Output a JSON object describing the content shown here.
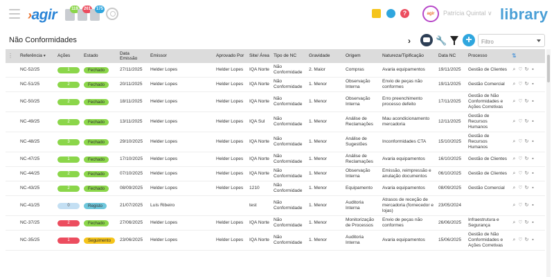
{
  "header": {
    "logo_prefix": "·",
    "logo_text": "agir",
    "notifications": [
      {
        "count": "119",
        "color": "#8bd64a"
      },
      {
        "count": "261",
        "color": "#ec4d5f"
      },
      {
        "count": "175",
        "color": "#2fa6de"
      }
    ],
    "user_name": "Patrícia Quintal",
    "user_chevron": "∨",
    "brand": "library",
    "avatar_text": "agir"
  },
  "page": {
    "title": "Não Conformidades",
    "filter_placeholder": "Filtro",
    "add_label": "+"
  },
  "columns": [
    "Referência",
    "Ações",
    "Estado",
    "Data Emissão",
    "Emissor",
    "Aprovado Por",
    "Site/ Área",
    "Tipo de NC",
    "Gravidade",
    "Origem",
    "Natureza/Tipificação",
    "Data NC",
    "Processo"
  ],
  "rows": [
    {
      "ref": "NC-52/25",
      "acoes": "1",
      "acoes_color": "g",
      "estado": "Fechado",
      "estado_cls": "fechado",
      "data": "27/11/2025",
      "emissor": "Helder Lopes",
      "aprovado": "Helder Lopes",
      "site": "IQA Norte",
      "tipo": "Não Conformidade",
      "gravidade": "2. Maior",
      "origem": "Compras",
      "natureza": "Avaria equipamentos",
      "data_nc": "19/11/2025",
      "processo": "Gestão de Clientes"
    },
    {
      "ref": "NC-51/25",
      "acoes": "2",
      "acoes_color": "g",
      "estado": "Fechado",
      "estado_cls": "fechado",
      "data": "20/11/2025",
      "emissor": "Helder Lopes",
      "aprovado": "Helder Lopes",
      "site": "IQA Norte",
      "tipo": "Não Conformidade",
      "gravidade": "1. Menor",
      "origem": "Observação Interna",
      "natureza": "Envio de peças não conformes",
      "data_nc": "19/11/2025",
      "processo": "Gestão Comercial"
    },
    {
      "ref": "NC-50/25",
      "acoes": "2",
      "acoes_color": "g",
      "estado": "Fechado",
      "estado_cls": "fechado",
      "data": "18/11/2025",
      "emissor": "Helder Lopes",
      "aprovado": "Helder Lopes",
      "site": "IQA Norte",
      "tipo": "Não Conformidade",
      "gravidade": "1. Menor",
      "origem": "Observação Interna",
      "natureza": "Erro preenchimento processo defeito",
      "data_nc": "17/11/2025",
      "processo": "Gestão de Não Conformidades e Ações Corretivas"
    },
    {
      "ref": "NC-49/25",
      "acoes": "2",
      "acoes_color": "g",
      "estado": "Fechado",
      "estado_cls": "fechado",
      "data": "13/11/2025",
      "emissor": "Helder Lopes",
      "aprovado": "Helder Lopes",
      "site": "IQA Sul",
      "tipo": "Não Conformidade",
      "gravidade": "1. Menor",
      "origem": "Análise de Reclamações",
      "natureza": "Mau acondicionamento mercadoria",
      "data_nc": "12/11/2025",
      "processo": "Gestão de Recursos Humanos"
    },
    {
      "ref": "NC-48/25",
      "acoes": "3",
      "acoes_color": "g",
      "estado": "Fechado",
      "estado_cls": "fechado",
      "data": "29/10/2025",
      "emissor": "Helder Lopes",
      "aprovado": "Helder Lopes",
      "site": "IQA Norte",
      "tipo": "Não Conformidade",
      "gravidade": "1. Menor",
      "origem": "Análise de Sugestões",
      "natureza": "Inconformidades CTA",
      "data_nc": "15/10/2025",
      "processo": "Gestão de Recursos Humanos"
    },
    {
      "ref": "NC-47/25",
      "acoes": "1",
      "acoes_color": "g",
      "estado": "Fechado",
      "estado_cls": "fechado",
      "data": "17/10/2025",
      "emissor": "Helder Lopes",
      "aprovado": "Helder Lopes",
      "site": "IQA Norte",
      "tipo": "Não Conformidade",
      "gravidade": "1. Menor",
      "origem": "Análise de Reclamações",
      "natureza": "Avaria equipamentos",
      "data_nc": "16/10/2025",
      "processo": "Gestão de Clientes"
    },
    {
      "ref": "NC-44/25",
      "acoes": "2",
      "acoes_color": "g",
      "estado": "Fechado",
      "estado_cls": "fechado",
      "data": "07/10/2025",
      "emissor": "Helder Lopes",
      "aprovado": "Helder Lopes",
      "site": "IQA Norte",
      "tipo": "Não Conformidade",
      "gravidade": "1. Menor",
      "origem": "Observação Interna",
      "natureza": "Emissão, reimpressão e anulação documentos",
      "data_nc": "06/10/2025",
      "processo": "Gestão de Clientes"
    },
    {
      "ref": "NC-43/25",
      "acoes": "2",
      "acoes_color": "g",
      "estado": "Fechado",
      "estado_cls": "fechado",
      "data": "08/09/2025",
      "emissor": "Helder Lopes",
      "aprovado": "Helder Lopes",
      "site": "1210",
      "tipo": "Não Conformidade",
      "gravidade": "1. Menor",
      "origem": "Equipamento",
      "natureza": "Avaria equipamentos",
      "data_nc": "08/09/2025",
      "processo": "Gestão Comercial"
    },
    {
      "ref": "NC-41/25",
      "acoes": "0",
      "acoes_color": "b",
      "estado": "Registo",
      "estado_cls": "registo",
      "data": "21/07/2025",
      "emissor": "Luís Ribeiro",
      "aprovado": "",
      "site": "test",
      "tipo": "Não Conformidade",
      "gravidade": "1. Menor",
      "origem": "Auditoria Interna",
      "natureza": "Atrasos de receção de mercadoria (fornecedor e lojas)",
      "data_nc": "23/05/2024",
      "processo": ""
    },
    {
      "ref": "NC-37/25",
      "acoes": "2",
      "acoes_color": "r",
      "estado": "Fechado",
      "estado_cls": "fechado",
      "data": "27/06/2025",
      "emissor": "Helder Lopes",
      "aprovado": "Helder Lopes",
      "site": "IQA Norte",
      "tipo": "Não Conformidade",
      "gravidade": "1. Menor",
      "origem": "Monitorização de Processos",
      "natureza": "Envio de peças não conformes",
      "data_nc": "26/06/2025",
      "processo": "Infraestrutura e Segurança"
    },
    {
      "ref": "NC-35/25",
      "acoes": "1",
      "acoes_color": "r",
      "estado": "Seguimento",
      "estado_cls": "seguimento",
      "data": "23/06/2025",
      "emissor": "Helder Lopes",
      "aprovado": "Helder Lopes",
      "site": "IQA Norte",
      "tipo": "Não Conformidade",
      "gravidade": "1. Menor",
      "origem": "Auditoria Interna",
      "natureza": "Avaria equipamentos",
      "data_nc": "15/06/2025",
      "processo": "Gestão de Não Conformidades e Ações Corretivas"
    }
  ],
  "colors": {
    "brand_blue": "#2a84d6",
    "fechado": "#8bd64a",
    "registo": "#6ec7dc",
    "seguimento": "#f5c41a",
    "alert_red": "#ec4d5f"
  }
}
